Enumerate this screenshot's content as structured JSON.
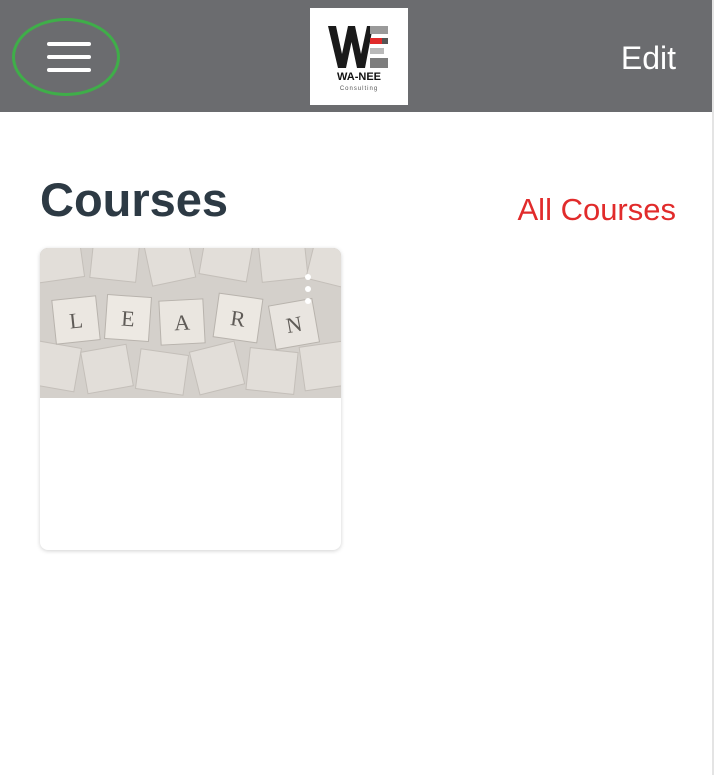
{
  "header": {
    "logo_text": "WA-NEE",
    "logo_subtext": "Consulting",
    "edit_label": "Edit"
  },
  "main": {
    "title": "Courses",
    "all_courses_label": "All Courses"
  },
  "courses": [
    {
      "image_tile_text": "LEARN"
    }
  ],
  "colors": {
    "header_bg": "#6b6c6f",
    "menu_highlight": "#3fae49",
    "title": "#2d3a44",
    "accent_link": "#e12b2b"
  },
  "icons": {
    "menu": "hamburger-menu-icon",
    "more": "vertical-ellipsis-icon"
  }
}
